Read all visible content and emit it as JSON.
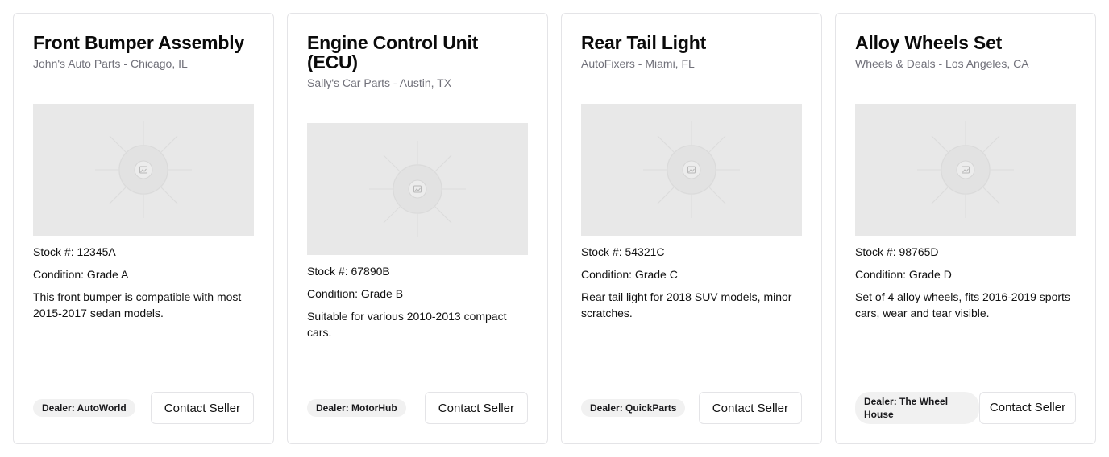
{
  "listings": [
    {
      "title": "Front Bumper Assembly",
      "subtitle": "John's Auto Parts - Chicago, IL",
      "stock": "Stock #: 12345A",
      "condition": "Condition: Grade A",
      "description": "This front bumper is compatible with most 2015-2017 sedan models.",
      "dealer": "Dealer: AutoWorld",
      "button": "Contact Seller"
    },
    {
      "title": "Engine Control Unit (ECU)",
      "subtitle": "Sally's Car Parts - Austin, TX",
      "stock": "Stock #: 67890B",
      "condition": "Condition: Grade B",
      "description": "Suitable for various 2010-2013 compact cars.",
      "dealer": "Dealer: MotorHub",
      "button": "Contact Seller"
    },
    {
      "title": "Rear Tail Light",
      "subtitle": "AutoFixers - Miami, FL",
      "stock": "Stock #: 54321C",
      "condition": "Condition: Grade C",
      "description": "Rear tail light for 2018 SUV models, minor scratches.",
      "dealer": "Dealer: QuickParts",
      "button": "Contact Seller"
    },
    {
      "title": "Alloy Wheels Set",
      "subtitle": "Wheels & Deals - Los Angeles, CA",
      "stock": "Stock #: 98765D",
      "condition": "Condition: Grade D",
      "description": "Set of 4 alloy wheels, fits 2016-2019 sports cars, wear and tear visible.",
      "dealer": "Dealer: The Wheel House",
      "button": "Contact Seller"
    }
  ],
  "icons": {
    "placeholder": "image-placeholder-icon"
  },
  "colors": {
    "placeholder_bg": "#e8e8e8",
    "border": "#e4e4e7",
    "muted_text": "#71717a",
    "badge_bg": "#f1f1f1"
  }
}
